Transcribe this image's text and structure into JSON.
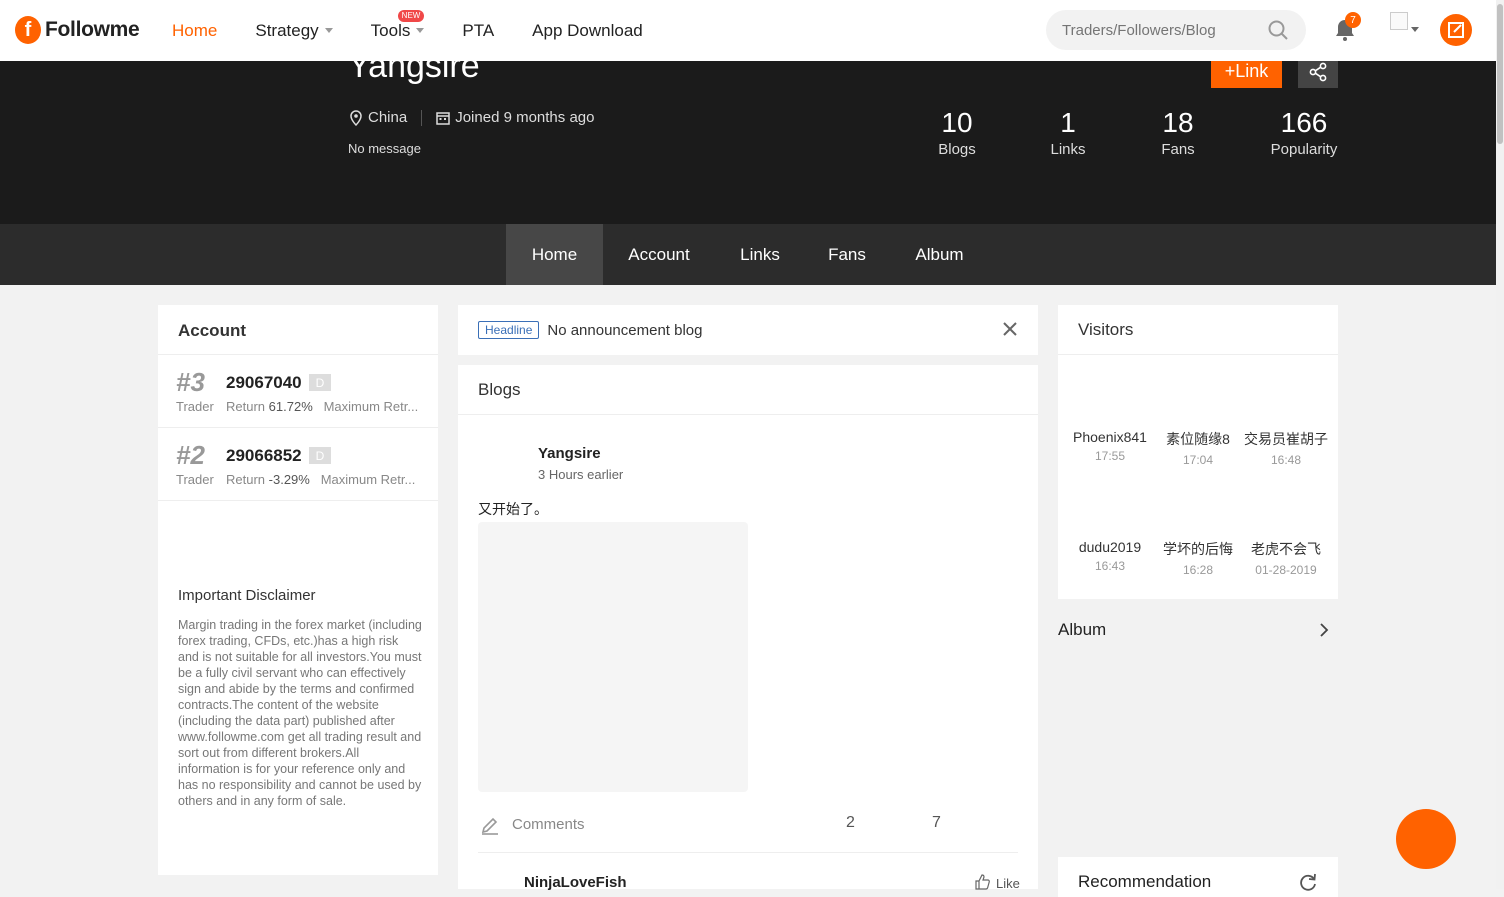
{
  "nav": {
    "logo_text": "Followme",
    "items": [
      {
        "label": "Home",
        "active": true
      },
      {
        "label": "Strategy"
      },
      {
        "label": "Tools",
        "badge": "NEW"
      },
      {
        "label": "PTA"
      },
      {
        "label": "App Download"
      }
    ],
    "search_placeholder": "Traders/Followers/Blog",
    "notification_count": "7"
  },
  "profile": {
    "name": "Yangsire",
    "location": "China",
    "joined": "Joined 9 months ago",
    "message": "No message",
    "link_button": "+Link",
    "stats": [
      {
        "value": "10",
        "label": "Blogs"
      },
      {
        "value": "1",
        "label": "Links"
      },
      {
        "value": "18",
        "label": "Fans"
      },
      {
        "value": "166",
        "label": "Popularity"
      }
    ]
  },
  "tabs": [
    "Home",
    "Account",
    "Links",
    "Fans",
    "Album"
  ],
  "account": {
    "title": "Account",
    "rows": [
      {
        "rank": "#3",
        "role": "Trader",
        "number": "29067040",
        "tag": "D",
        "return_label": "Return",
        "return_value": "61.72%",
        "extra": "Maximum Retr..."
      },
      {
        "rank": "#2",
        "role": "Trader",
        "number": "29066852",
        "tag": "D",
        "return_label": "Return",
        "return_value": "-3.29%",
        "extra": "Maximum Retr..."
      }
    ],
    "disclaimer_title": "Important Disclaimer",
    "disclaimer_text": "Margin trading in the forex market (including forex trading, CFDs, etc.)has a high risk and is not suitable for all investors.You must be a fully civil servant who can effectively sign and abide by the terms and confirmed contracts.The content of the website (including the data part) published after www.followme.com get all trading result and sort out from different brokers.All information is for your reference only and has no responsibility and cannot be used by others and in any form of sale."
  },
  "headline": {
    "tag": "Headline",
    "text": "No announcement blog"
  },
  "blogs": {
    "title": "Blogs",
    "post": {
      "author": "Yangsire",
      "time": "3 Hours earlier",
      "text": "又开始了。",
      "comments_label": "Comments",
      "count_a": "2",
      "count_b": "7"
    },
    "reply": {
      "author": "NinjaLoveFish",
      "like_label": "Like"
    }
  },
  "visitors": {
    "title": "Visitors",
    "list": [
      {
        "name": "Phoenix841",
        "time": "17:55"
      },
      {
        "name": "素位随缘8",
        "time": "17:04"
      },
      {
        "name": "交易员崔胡子",
        "time": "16:48"
      },
      {
        "name": "dudu2019",
        "time": "16:43"
      },
      {
        "name": "学坏的后悔",
        "time": "16:28"
      },
      {
        "name": "老虎不会飞",
        "time": "01-28-2019"
      }
    ]
  },
  "album": {
    "label": "Album"
  },
  "recommendation": {
    "label": "Recommendation"
  },
  "colors": {
    "accent": "#ff6200",
    "hero_bg": "#1b1b1b",
    "tabs_bg": "#2c2c2c"
  }
}
